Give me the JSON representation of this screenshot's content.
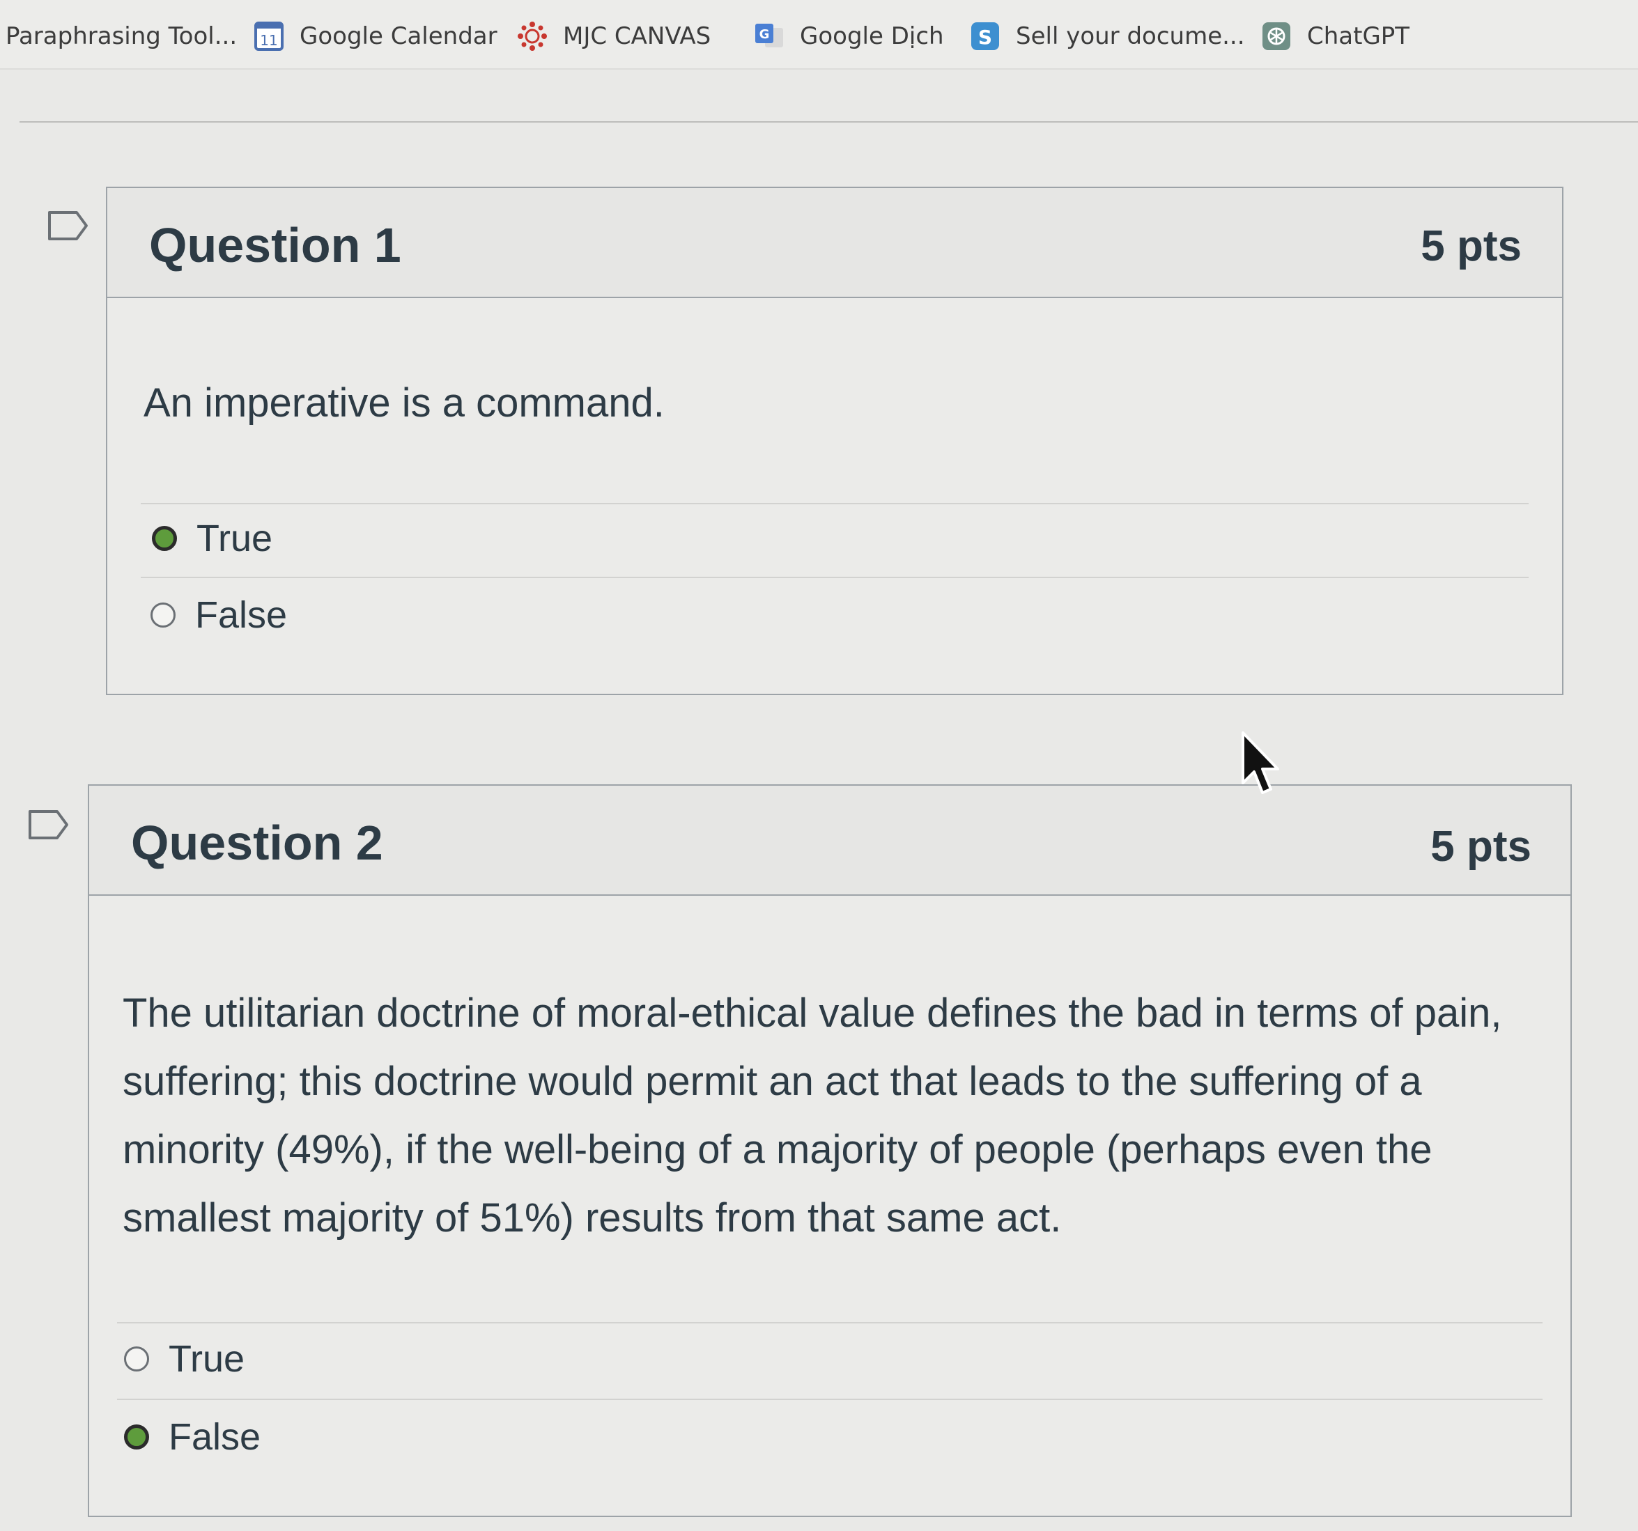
{
  "bookmarks": [
    {
      "label": "Paraphrasing Tool...",
      "icon": "none"
    },
    {
      "label": "Google Calendar",
      "icon": "calendar-icon",
      "icon_text": "11"
    },
    {
      "label": "MJC CANVAS",
      "icon": "canvas-icon"
    },
    {
      "label": "Google Dịch",
      "icon": "google-translate-icon",
      "icon_text": "G"
    },
    {
      "label": "Sell your docume...",
      "icon": "s-icon",
      "icon_text": "S"
    },
    {
      "label": "ChatGPT",
      "icon": "chatgpt-icon"
    }
  ],
  "questions": [
    {
      "title": "Question 1",
      "points": "5 pts",
      "text": "An imperative is a command.",
      "answers": [
        {
          "label": "True",
          "selected": true
        },
        {
          "label": "False",
          "selected": false
        }
      ]
    },
    {
      "title": "Question 2",
      "points": "5 pts",
      "text": "The utilitarian doctrine of moral-ethical value defines the bad in terms of pain, suffering; this doctrine would permit an act that leads to the suffering of a minority (49%), if the well-being of a majority of people (perhaps even the smallest majority of 51%) results from that same act.",
      "answers": [
        {
          "label": "True",
          "selected": false
        },
        {
          "label": "False",
          "selected": true
        }
      ]
    }
  ],
  "colors": {
    "selected_radio": "#5e9c3c",
    "text": "#2d3b45",
    "calendar_blue": "#4a6fb0",
    "canvas_red": "#c8372f",
    "sell_blue": "#3d8fd0",
    "chatgpt_green": "#6f8f86"
  }
}
